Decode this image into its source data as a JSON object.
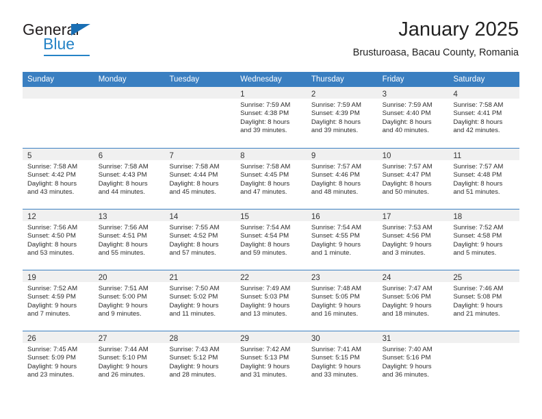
{
  "brand": {
    "name_part1": "General",
    "name_part2": "Blue",
    "triangle_color": "#1a6fb4",
    "blue_color": "#2583c6"
  },
  "header": {
    "title": "January 2025",
    "subtitle": "Brusturoasa, Bacau County, Romania"
  },
  "theme": {
    "header_blue": "#3a7fc1",
    "day_band_gray": "#f0f0f0",
    "text_color": "#2b2b2b"
  },
  "weekdays": [
    {
      "label": "Sunday"
    },
    {
      "label": "Monday"
    },
    {
      "label": "Tuesday"
    },
    {
      "label": "Wednesday"
    },
    {
      "label": "Thursday"
    },
    {
      "label": "Friday"
    },
    {
      "label": "Saturday"
    }
  ],
  "weeks": [
    {
      "days": [
        {
          "num": "",
          "empty": true,
          "sunrise": "",
          "sunset": "",
          "daylight1": "",
          "daylight2": ""
        },
        {
          "num": "",
          "empty": true,
          "sunrise": "",
          "sunset": "",
          "daylight1": "",
          "daylight2": ""
        },
        {
          "num": "",
          "empty": true,
          "sunrise": "",
          "sunset": "",
          "daylight1": "",
          "daylight2": ""
        },
        {
          "num": "1",
          "empty": false,
          "sunrise": "Sunrise: 7:59 AM",
          "sunset": "Sunset: 4:38 PM",
          "daylight1": "Daylight: 8 hours",
          "daylight2": "and 39 minutes."
        },
        {
          "num": "2",
          "empty": false,
          "sunrise": "Sunrise: 7:59 AM",
          "sunset": "Sunset: 4:39 PM",
          "daylight1": "Daylight: 8 hours",
          "daylight2": "and 39 minutes."
        },
        {
          "num": "3",
          "empty": false,
          "sunrise": "Sunrise: 7:59 AM",
          "sunset": "Sunset: 4:40 PM",
          "daylight1": "Daylight: 8 hours",
          "daylight2": "and 40 minutes."
        },
        {
          "num": "4",
          "empty": false,
          "sunrise": "Sunrise: 7:58 AM",
          "sunset": "Sunset: 4:41 PM",
          "daylight1": "Daylight: 8 hours",
          "daylight2": "and 42 minutes."
        }
      ]
    },
    {
      "days": [
        {
          "num": "5",
          "empty": false,
          "sunrise": "Sunrise: 7:58 AM",
          "sunset": "Sunset: 4:42 PM",
          "daylight1": "Daylight: 8 hours",
          "daylight2": "and 43 minutes."
        },
        {
          "num": "6",
          "empty": false,
          "sunrise": "Sunrise: 7:58 AM",
          "sunset": "Sunset: 4:43 PM",
          "daylight1": "Daylight: 8 hours",
          "daylight2": "and 44 minutes."
        },
        {
          "num": "7",
          "empty": false,
          "sunrise": "Sunrise: 7:58 AM",
          "sunset": "Sunset: 4:44 PM",
          "daylight1": "Daylight: 8 hours",
          "daylight2": "and 45 minutes."
        },
        {
          "num": "8",
          "empty": false,
          "sunrise": "Sunrise: 7:58 AM",
          "sunset": "Sunset: 4:45 PM",
          "daylight1": "Daylight: 8 hours",
          "daylight2": "and 47 minutes."
        },
        {
          "num": "9",
          "empty": false,
          "sunrise": "Sunrise: 7:57 AM",
          "sunset": "Sunset: 4:46 PM",
          "daylight1": "Daylight: 8 hours",
          "daylight2": "and 48 minutes."
        },
        {
          "num": "10",
          "empty": false,
          "sunrise": "Sunrise: 7:57 AM",
          "sunset": "Sunset: 4:47 PM",
          "daylight1": "Daylight: 8 hours",
          "daylight2": "and 50 minutes."
        },
        {
          "num": "11",
          "empty": false,
          "sunrise": "Sunrise: 7:57 AM",
          "sunset": "Sunset: 4:48 PM",
          "daylight1": "Daylight: 8 hours",
          "daylight2": "and 51 minutes."
        }
      ]
    },
    {
      "days": [
        {
          "num": "12",
          "empty": false,
          "sunrise": "Sunrise: 7:56 AM",
          "sunset": "Sunset: 4:50 PM",
          "daylight1": "Daylight: 8 hours",
          "daylight2": "and 53 minutes."
        },
        {
          "num": "13",
          "empty": false,
          "sunrise": "Sunrise: 7:56 AM",
          "sunset": "Sunset: 4:51 PM",
          "daylight1": "Daylight: 8 hours",
          "daylight2": "and 55 minutes."
        },
        {
          "num": "14",
          "empty": false,
          "sunrise": "Sunrise: 7:55 AM",
          "sunset": "Sunset: 4:52 PM",
          "daylight1": "Daylight: 8 hours",
          "daylight2": "and 57 minutes."
        },
        {
          "num": "15",
          "empty": false,
          "sunrise": "Sunrise: 7:54 AM",
          "sunset": "Sunset: 4:54 PM",
          "daylight1": "Daylight: 8 hours",
          "daylight2": "and 59 minutes."
        },
        {
          "num": "16",
          "empty": false,
          "sunrise": "Sunrise: 7:54 AM",
          "sunset": "Sunset: 4:55 PM",
          "daylight1": "Daylight: 9 hours",
          "daylight2": "and 1 minute."
        },
        {
          "num": "17",
          "empty": false,
          "sunrise": "Sunrise: 7:53 AM",
          "sunset": "Sunset: 4:56 PM",
          "daylight1": "Daylight: 9 hours",
          "daylight2": "and 3 minutes."
        },
        {
          "num": "18",
          "empty": false,
          "sunrise": "Sunrise: 7:52 AM",
          "sunset": "Sunset: 4:58 PM",
          "daylight1": "Daylight: 9 hours",
          "daylight2": "and 5 minutes."
        }
      ]
    },
    {
      "days": [
        {
          "num": "19",
          "empty": false,
          "sunrise": "Sunrise: 7:52 AM",
          "sunset": "Sunset: 4:59 PM",
          "daylight1": "Daylight: 9 hours",
          "daylight2": "and 7 minutes."
        },
        {
          "num": "20",
          "empty": false,
          "sunrise": "Sunrise: 7:51 AM",
          "sunset": "Sunset: 5:00 PM",
          "daylight1": "Daylight: 9 hours",
          "daylight2": "and 9 minutes."
        },
        {
          "num": "21",
          "empty": false,
          "sunrise": "Sunrise: 7:50 AM",
          "sunset": "Sunset: 5:02 PM",
          "daylight1": "Daylight: 9 hours",
          "daylight2": "and 11 minutes."
        },
        {
          "num": "22",
          "empty": false,
          "sunrise": "Sunrise: 7:49 AM",
          "sunset": "Sunset: 5:03 PM",
          "daylight1": "Daylight: 9 hours",
          "daylight2": "and 13 minutes."
        },
        {
          "num": "23",
          "empty": false,
          "sunrise": "Sunrise: 7:48 AM",
          "sunset": "Sunset: 5:05 PM",
          "daylight1": "Daylight: 9 hours",
          "daylight2": "and 16 minutes."
        },
        {
          "num": "24",
          "empty": false,
          "sunrise": "Sunrise: 7:47 AM",
          "sunset": "Sunset: 5:06 PM",
          "daylight1": "Daylight: 9 hours",
          "daylight2": "and 18 minutes."
        },
        {
          "num": "25",
          "empty": false,
          "sunrise": "Sunrise: 7:46 AM",
          "sunset": "Sunset: 5:08 PM",
          "daylight1": "Daylight: 9 hours",
          "daylight2": "and 21 minutes."
        }
      ]
    },
    {
      "days": [
        {
          "num": "26",
          "empty": false,
          "sunrise": "Sunrise: 7:45 AM",
          "sunset": "Sunset: 5:09 PM",
          "daylight1": "Daylight: 9 hours",
          "daylight2": "and 23 minutes."
        },
        {
          "num": "27",
          "empty": false,
          "sunrise": "Sunrise: 7:44 AM",
          "sunset": "Sunset: 5:10 PM",
          "daylight1": "Daylight: 9 hours",
          "daylight2": "and 26 minutes."
        },
        {
          "num": "28",
          "empty": false,
          "sunrise": "Sunrise: 7:43 AM",
          "sunset": "Sunset: 5:12 PM",
          "daylight1": "Daylight: 9 hours",
          "daylight2": "and 28 minutes."
        },
        {
          "num": "29",
          "empty": false,
          "sunrise": "Sunrise: 7:42 AM",
          "sunset": "Sunset: 5:13 PM",
          "daylight1": "Daylight: 9 hours",
          "daylight2": "and 31 minutes."
        },
        {
          "num": "30",
          "empty": false,
          "sunrise": "Sunrise: 7:41 AM",
          "sunset": "Sunset: 5:15 PM",
          "daylight1": "Daylight: 9 hours",
          "daylight2": "and 33 minutes."
        },
        {
          "num": "31",
          "empty": false,
          "sunrise": "Sunrise: 7:40 AM",
          "sunset": "Sunset: 5:16 PM",
          "daylight1": "Daylight: 9 hours",
          "daylight2": "and 36 minutes."
        },
        {
          "num": "",
          "empty": true,
          "sunrise": "",
          "sunset": "",
          "daylight1": "",
          "daylight2": ""
        }
      ]
    }
  ]
}
